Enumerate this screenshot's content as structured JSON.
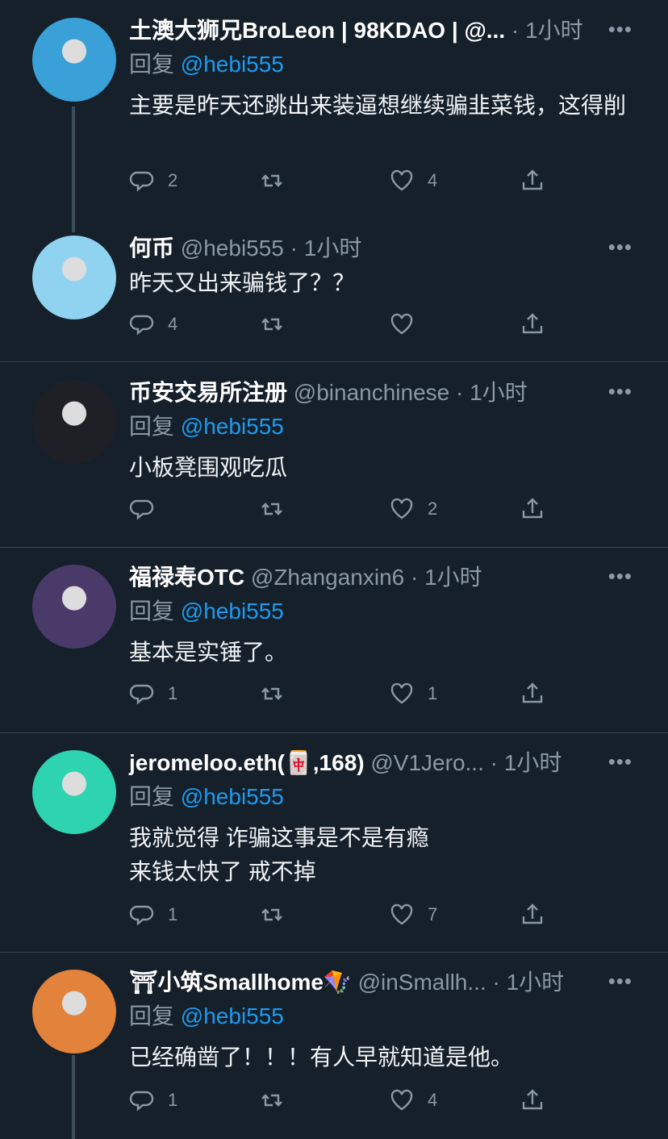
{
  "reply_prefix": "回复",
  "tweets": [
    {
      "name": "土澳大狮兄BroLeon | 98KDAO | @...",
      "handle": "",
      "time": "· 1小时",
      "reply_to": "@hebi555",
      "text": "主要是昨天还跳出来装逼想继续骗韭菜钱，这得削",
      "replies": "2",
      "retweets": "",
      "likes": "4",
      "avatar_color": "#3aa0d8"
    },
    {
      "name": "何币",
      "handle": "@hebi555",
      "time": "· 1小时",
      "reply_to": "",
      "text": "昨天又出来骗钱了？？",
      "replies": "4",
      "retweets": "",
      "likes": "",
      "avatar_color": "#8fd3f0"
    },
    {
      "name": "币安交易所注册",
      "handle": "@binanchinese",
      "time": "· 1小时",
      "reply_to": "@hebi555",
      "text": "小板凳围观吃瓜",
      "replies": "",
      "retweets": "",
      "likes": "2",
      "avatar_color": "#1e2026"
    },
    {
      "name": "福禄寿OTC",
      "handle": "@Zhanganxin6",
      "time": "· 1小时",
      "reply_to": "@hebi555",
      "text": "基本是实锤了。",
      "replies": "1",
      "retweets": "",
      "likes": "1",
      "avatar_color": "#4a3a6a"
    },
    {
      "name": "jeromeloo.eth(🀄,168)",
      "handle": "@V1Jero...",
      "time": "· 1小时",
      "reply_to": "@hebi555",
      "text": "我就觉得 诈骗这事是不是有瘾\n来钱太快了 戒不掉",
      "replies": "1",
      "retweets": "",
      "likes": "7",
      "avatar_color": "#2ed3b0"
    },
    {
      "name": "⛩小筑Smallhome🪁",
      "handle": "@inSmallh...",
      "time": "· 1小时",
      "reply_to": "@hebi555",
      "text": "已经确凿了！！！有人早就知道是他。",
      "replies": "1",
      "retweets": "",
      "likes": "4",
      "avatar_color": "#e3823a"
    }
  ],
  "more_label": "•••"
}
